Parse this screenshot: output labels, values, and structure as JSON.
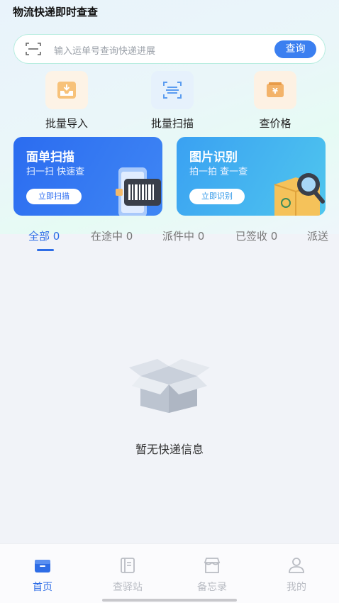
{
  "app": {
    "title": "物流快递即时查查"
  },
  "search": {
    "placeholder": "输入运单号查询快递进展",
    "button_label": "查询"
  },
  "quick_actions": [
    {
      "label": "批量导入",
      "icon": "inbox-import-icon"
    },
    {
      "label": "批量扫描",
      "icon": "scan-document-icon"
    },
    {
      "label": "查价格",
      "icon": "price-tag-icon"
    }
  ],
  "cards": [
    {
      "title": "面单扫描",
      "subtitle": "扫一扫 快速查",
      "button": "立即扫描",
      "icon": "barcode-phone-icon"
    },
    {
      "title": "图片识别",
      "subtitle": "拍一拍 查一查",
      "button": "立即识别",
      "icon": "package-magnifier-icon"
    }
  ],
  "tabs": [
    {
      "label": "全部 0",
      "active": true
    },
    {
      "label": "在途中 0"
    },
    {
      "label": "派件中 0"
    },
    {
      "label": "已签收 0"
    },
    {
      "label": "派送"
    }
  ],
  "empty_state": {
    "text": "暂无快递信息",
    "icon": "empty-box-icon"
  },
  "bottom_nav": [
    {
      "label": "首页",
      "icon": "home-box-icon",
      "active": true
    },
    {
      "label": "查驿站",
      "icon": "book-icon"
    },
    {
      "label": "备忘录",
      "icon": "store-icon"
    },
    {
      "label": "我的",
      "icon": "user-icon"
    }
  ],
  "colors": {
    "primary": "#2e6de6",
    "card_blue": "#2b6cf0",
    "card_cyan": "#4fc6ee",
    "accent_orange": "#f0a545"
  }
}
